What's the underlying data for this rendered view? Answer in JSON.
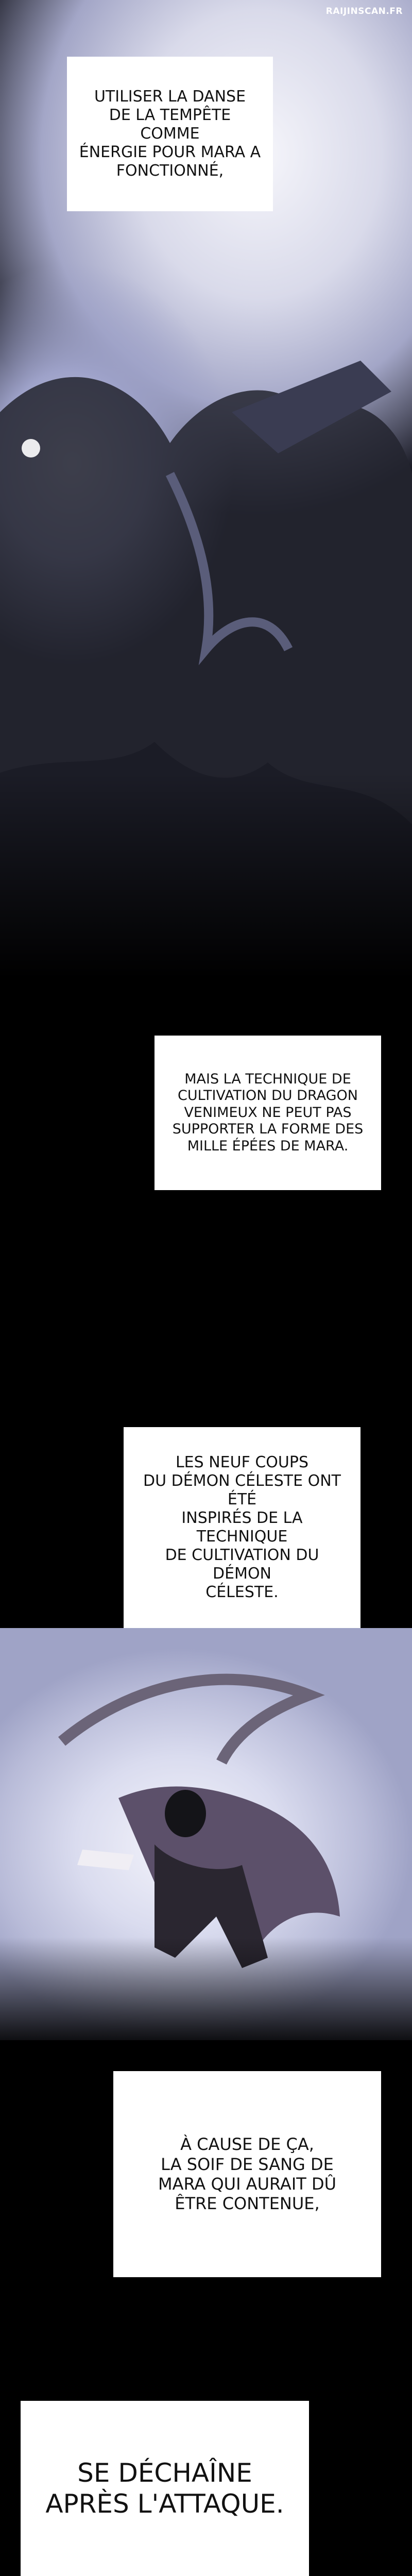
{
  "watermark": "RAIJINSCAN.FR",
  "captions": [
    "UTILISER LA DANSE\nDE LA TEMPÊTE COMME\nÉNERGIE POUR MARA A\nFONCTIONNÉ,",
    "MAIS LA TECHNIQUE DE\nCULTIVATION DU DRAGON\nVENIMEUX NE PEUT PAS\nSUPPORTER LA FORME DES\nMILLE ÉPÉES DE MARA.",
    "LES NEUF COUPS\nDU DÉMON CÉLESTE ONT ÉTÉ\nINSPIRÉS DE LA TECHNIQUE\nDE CULTIVATION DU DÉMON\nCÉLESTE.",
    "À CAUSE DE ÇA,\nLA SOIF DE SANG DE\nMARA QUI AURAIT DÛ\nÊTRE CONTENUE,",
    "SE DÉCHAÎNE\nAPRÈS L'ATTAQUE."
  ]
}
